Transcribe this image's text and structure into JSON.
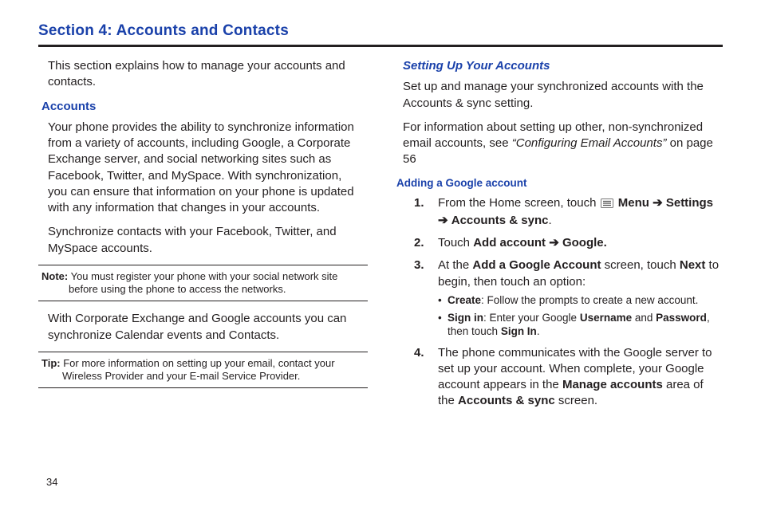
{
  "page_number": "34",
  "section_title": "Section 4: Accounts and Contacts",
  "left": {
    "intro": "This section explains how to manage your accounts and contacts.",
    "h_accounts": "Accounts",
    "p1": "Your phone provides the ability to synchronize information from a variety of accounts, including Google, a Corporate Exchange server, and social networking sites such as Facebook, Twitter, and MySpace. With synchronization, you can ensure that information on your phone is updated with any information that changes in your accounts.",
    "p2": "Synchronize contacts with your Facebook, Twitter, and MySpace accounts.",
    "note_label": "Note:",
    "note_text": " You must register your phone with your social network site before using the phone to access the networks.",
    "p3": "With Corporate Exchange and Google accounts you can synchronize Calendar events and Contacts.",
    "tip_label": "Tip:",
    "tip_text": " For more information on setting up your email, contact your Wireless Provider and your E-mail Service Provider."
  },
  "right": {
    "h_setup": "Setting Up Your Accounts",
    "p1": "Set up and manage your synchronized accounts with the Accounts & sync setting.",
    "p2_a": "For information about setting up other, non-synchronized email accounts, see ",
    "p2_ref": "“Configuring Email Accounts”",
    "p2_b": " on page 56",
    "h_add_google": "Adding a Google account",
    "s1_a": "From the Home screen, touch ",
    "s1_menu": "Menu",
    "s1_arrow1": " ➔ ",
    "s1_settings": "Settings",
    "s1_arrow2": " ➔ ",
    "s1_accounts": "Accounts & sync",
    "s1_period": ".",
    "s2_a": "Touch ",
    "s2_addaccount": "Add account",
    "s2_arrow": " ➔ ",
    "s2_google": "Google.",
    "s3_a": "At the ",
    "s3_addgoogle": "Add a Google Account",
    "s3_b": " screen, touch ",
    "s3_next": "Next",
    "s3_c": " to begin, then touch an option:",
    "b1_label": "Create",
    "b1_text": ": Follow the prompts to create a new account.",
    "b2_label": "Sign in",
    "b2_a": ": Enter your Google ",
    "b2_user": "Username",
    "b2_and": " and ",
    "b2_pass": "Password",
    "b2_then": ", then touch ",
    "b2_signin": "Sign In",
    "b2_period": ".",
    "s4_a": "The phone communicates with the Google server to set up your account. When complete, your Google account appears in the ",
    "s4_manage": "Manage accounts",
    "s4_b": "  area of the ",
    "s4_accounts": "Accounts & sync",
    "s4_c": "  screen."
  }
}
